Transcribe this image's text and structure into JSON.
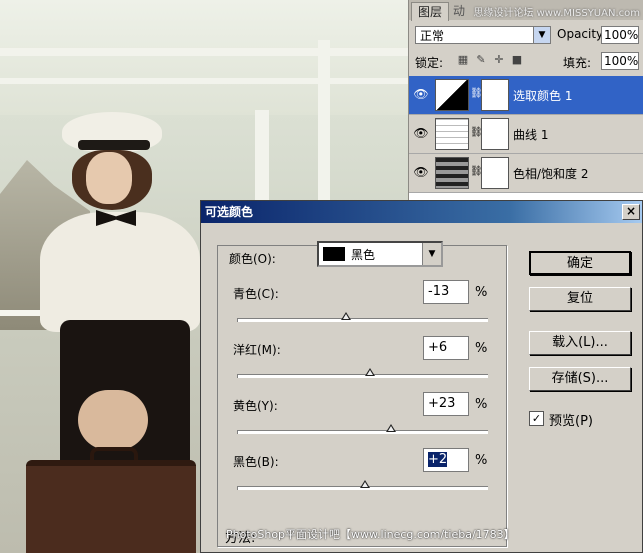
{
  "layers_panel": {
    "tab_layers": "图层",
    "tab_other": "动",
    "watermark_top": "思缘设计论坛 www.MISSYUAN.com",
    "blend_mode": "正常",
    "opacity_label": "Opacity:",
    "opacity_value": "100%",
    "lock_label": "锁定:",
    "fill_label": "填充:",
    "fill_value": "100%",
    "layers": [
      {
        "name": "选取颜色 1",
        "selected": true
      },
      {
        "name": "曲线 1",
        "selected": false
      },
      {
        "name": "色相/饱和度 2",
        "selected": false
      }
    ]
  },
  "dialog": {
    "title": "可选颜色",
    "close_glyph": "×",
    "color_label": "颜色(O):",
    "color_value": "黑色",
    "sliders": [
      {
        "label": "青色(C):",
        "value": "-13",
        "unit": "%",
        "level": -13
      },
      {
        "label": "洋红(M):",
        "value": "+6",
        "unit": "%",
        "level": 6
      },
      {
        "label": "黄色(Y):",
        "value": "+23",
        "unit": "%",
        "level": 23
      },
      {
        "label": "黑色(B):",
        "value": "+2",
        "unit": "%",
        "level": 2
      }
    ],
    "buttons": {
      "ok": "确定",
      "reset": "复位",
      "load": "载入(L)...",
      "save": "存储(S)..."
    },
    "preview_label": "预览(P)",
    "preview_checked": "☑",
    "method_label": "方法:"
  },
  "watermark_bottom": "PhotoShop平面设计吧【www.linecg.com/tieba/1783】",
  "colors": {
    "title_bar": "#0a246a",
    "selected_layer": "#3163c6"
  }
}
